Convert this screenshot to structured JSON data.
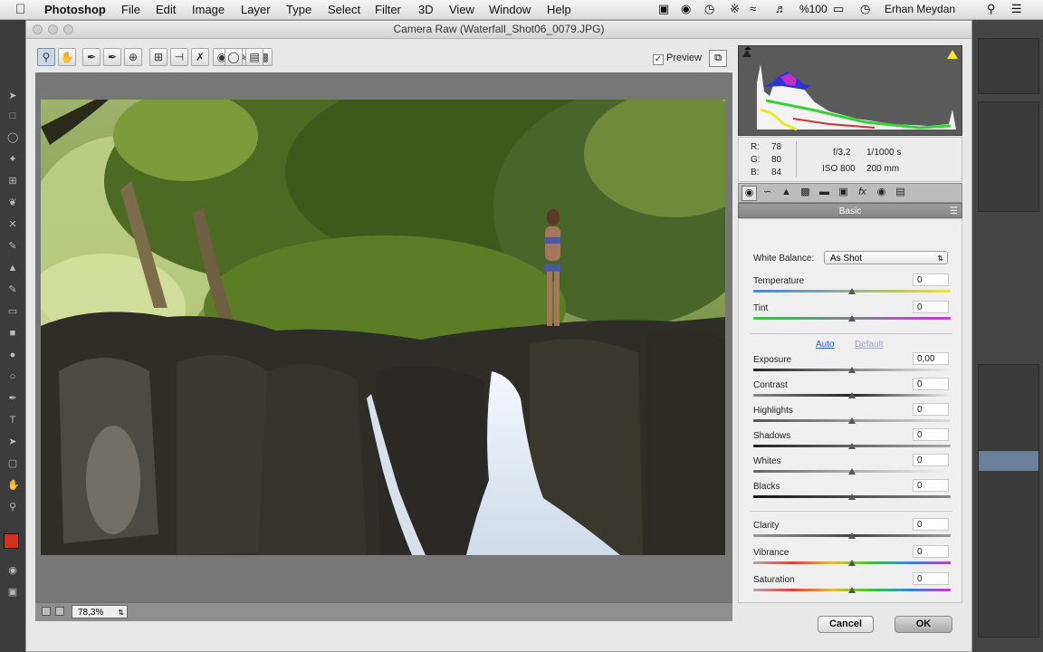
{
  "menubar": {
    "app_name": "Photoshop",
    "menus": [
      "File",
      "Edit",
      "Image",
      "Layer",
      "Type",
      "Select",
      "Filter",
      "3D",
      "View",
      "Window",
      "Help"
    ],
    "battery": "%100",
    "user": "Erhan Meydan"
  },
  "dialog": {
    "title": "Camera Raw (Waterfall_Shot06_0079.JPG)",
    "preview_label": "Preview",
    "preview_checked": true,
    "zoom": "78,3%"
  },
  "info": {
    "r_label": "R:",
    "r_value": "78",
    "g_label": "G:",
    "g_value": "80",
    "b_label": "B:",
    "b_value": "84",
    "aperture": "f/3,2",
    "shutter": "1/1000 s",
    "iso": "ISO 800",
    "focal": "200 mm"
  },
  "panel": {
    "section_title": "Basic",
    "white_balance_label": "White Balance:",
    "white_balance_value": "As Shot",
    "auto_label": "Auto",
    "default_label": "Default",
    "sliders": [
      {
        "label": "Temperature",
        "value": "0"
      },
      {
        "label": "Tint",
        "value": "0"
      },
      {
        "label": "Exposure",
        "value": "0,00"
      },
      {
        "label": "Contrast",
        "value": "0"
      },
      {
        "label": "Highlights",
        "value": "0"
      },
      {
        "label": "Shadows",
        "value": "0"
      },
      {
        "label": "Whites",
        "value": "0"
      },
      {
        "label": "Blacks",
        "value": "0"
      },
      {
        "label": "Clarity",
        "value": "0"
      },
      {
        "label": "Vibrance",
        "value": "0"
      },
      {
        "label": "Saturation",
        "value": "0"
      }
    ]
  },
  "buttons": {
    "cancel": "Cancel",
    "ok": "OK"
  },
  "colors": {
    "foreground_swatch": "#d8301c",
    "accent_link": "#2a5bd7"
  }
}
